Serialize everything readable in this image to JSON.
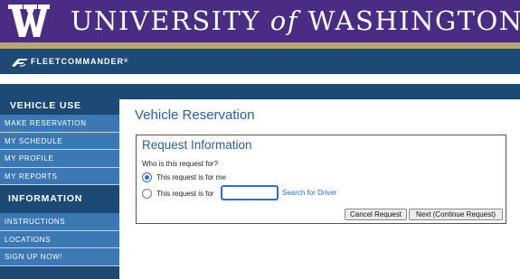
{
  "banner": {
    "logo_letter": "W",
    "title_part1": "UNIVERSITY",
    "title_of": "of",
    "title_part2": "WASHINGTON",
    "colors": {
      "purple": "#4b2c85",
      "gold": "#b7a57a"
    }
  },
  "fleet_bar": {
    "logo_text": "FLEETCOMMANDER",
    "logo_mark": "®",
    "color": "#1c4a74"
  },
  "sidebar": {
    "section1_heading": "VEHICLE USE",
    "section1_items": [
      {
        "label": "MAKE RESERVATION"
      },
      {
        "label": "MY SCHEDULE"
      },
      {
        "label": "MY PROFILE"
      },
      {
        "label": "MY REPORTS"
      }
    ],
    "section2_heading": "INFORMATION",
    "section2_items": [
      {
        "label": "INSTRUCTIONS"
      },
      {
        "label": "LOCATIONS"
      },
      {
        "label": "SIGN UP NOW!"
      }
    ]
  },
  "main": {
    "page_title": "Vehicle Reservation",
    "panel": {
      "title": "Request Information",
      "question": "Who is this request for?",
      "option_me": "This request is for me",
      "option_for": "This request is for",
      "driver_input_value": "",
      "search_link": "Search for Driver",
      "cancel_button": "Cancel Request",
      "next_button": "Next (Continue Request)"
    }
  }
}
